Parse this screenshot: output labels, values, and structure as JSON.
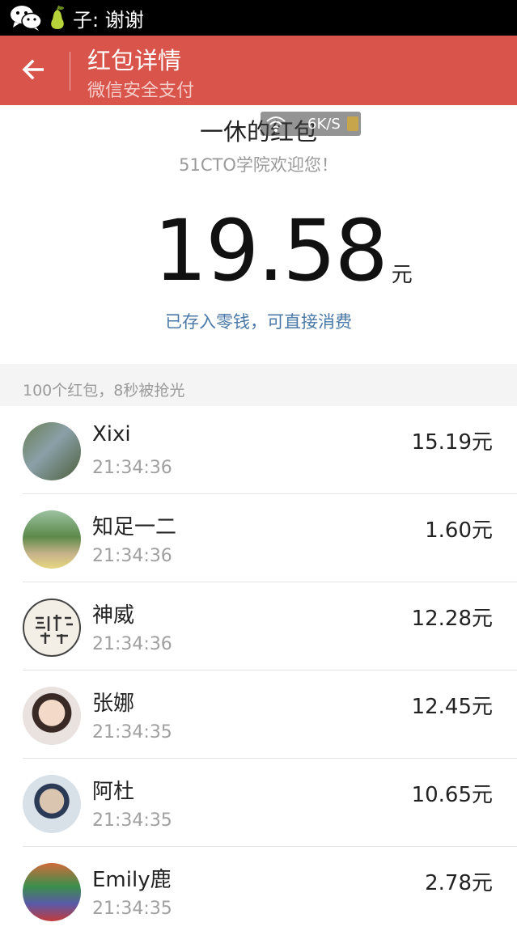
{
  "statusbar": {
    "icons": [
      "wechat-icon",
      "pear-icon"
    ],
    "text": "子: 谢谢"
  },
  "header": {
    "title": "红包详情",
    "subtitle": "微信安全支付",
    "back_icon": "back-arrow-icon",
    "color": "#d9544a"
  },
  "summary": {
    "sender": "一休的红包",
    "greeting": "51CTO学院欢迎您！",
    "amount": "19.58",
    "unit": "元",
    "note": "已存入零钱，可直接消费",
    "note_color": "#4a79a8"
  },
  "overlay": {
    "speed": "6K/S"
  },
  "stats": {
    "text": "100个红包，8秒被抢光"
  },
  "records": [
    {
      "name": "Xixi",
      "time": "21:34:36",
      "amount": "15.19元"
    },
    {
      "name": "知足一二",
      "time": "21:34:36",
      "amount": "1.60元"
    },
    {
      "name": "神威",
      "time": "21:34:36",
      "amount": "12.28元"
    },
    {
      "name": "张娜",
      "time": "21:34:35",
      "amount": "12.45元"
    },
    {
      "name": "阿杜",
      "time": "21:34:35",
      "amount": "10.65元"
    },
    {
      "name": "Emily鹿",
      "time": "21:34:35",
      "amount": "2.78元"
    }
  ]
}
